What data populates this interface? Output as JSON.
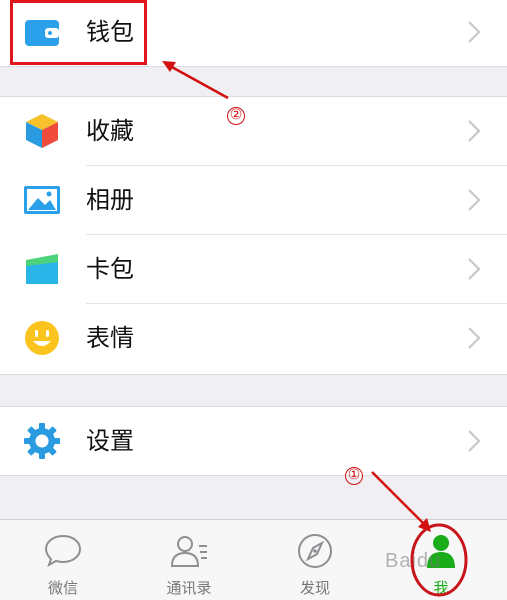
{
  "groups": [
    {
      "rows": [
        {
          "label": "钱包",
          "icon": "wallet-icon"
        }
      ]
    },
    {
      "rows": [
        {
          "label": "收藏",
          "icon": "favorites-cube-icon"
        },
        {
          "label": "相册",
          "icon": "album-image-icon"
        },
        {
          "label": "卡包",
          "icon": "card-package-icon"
        },
        {
          "label": "表情",
          "icon": "smiley-face-icon"
        }
      ]
    },
    {
      "rows": [
        {
          "label": "设置",
          "icon": "settings-gear-icon"
        }
      ]
    }
  ],
  "tabbar": {
    "tabs": [
      {
        "label": "微信",
        "icon": "chat-bubble-icon",
        "active": false
      },
      {
        "label": "通讯录",
        "icon": "contacts-icon",
        "active": false
      },
      {
        "label": "发现",
        "icon": "compass-icon",
        "active": false
      },
      {
        "label": "我",
        "icon": "me-person-icon",
        "active": true
      }
    ]
  },
  "annotations": {
    "step1": "①",
    "step2": "②",
    "color": "#e0161c"
  },
  "watermark": "Baidu"
}
